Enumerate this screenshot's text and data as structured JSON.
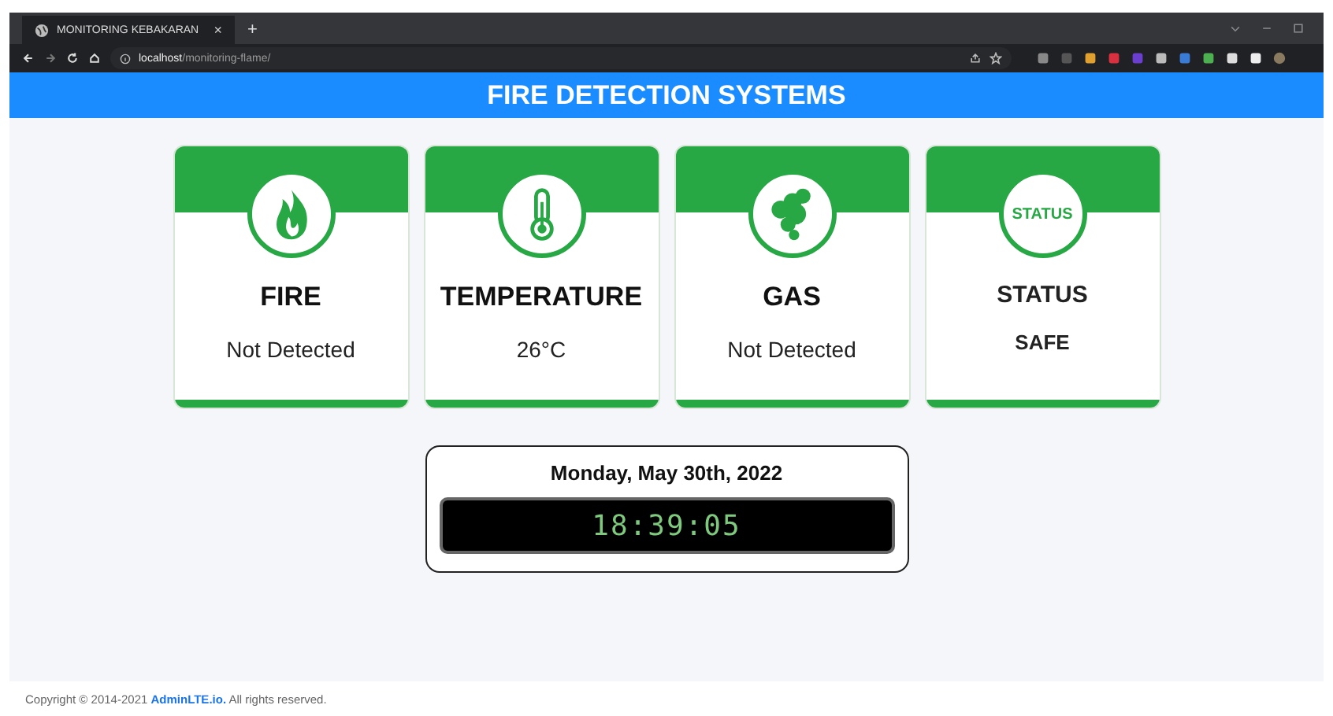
{
  "browser": {
    "tab_title": "MONITORING KEBAKARAN",
    "tab_close": "×",
    "new_tab": "+",
    "url_host": "localhost",
    "url_path": "/monitoring-flame/"
  },
  "header": {
    "title": "FIRE DETECTION SYSTEMS"
  },
  "cards": [
    {
      "kind": "fire",
      "title": "FIRE",
      "value": "Not Detected"
    },
    {
      "kind": "temperature",
      "title": "TEMPERATURE",
      "value": "26°C"
    },
    {
      "kind": "gas",
      "title": "GAS",
      "value": "Not Detected"
    },
    {
      "kind": "status",
      "title": "STATUS",
      "value": "SAFE",
      "badge": "STATUS"
    }
  ],
  "clock": {
    "date": "Monday, May 30th, 2022",
    "time": "18:39:05"
  },
  "footer": {
    "prefix": "Copyright © 2014-2021",
    "link": "AdminLTE.io.",
    "suffix": "All rights reserved."
  }
}
